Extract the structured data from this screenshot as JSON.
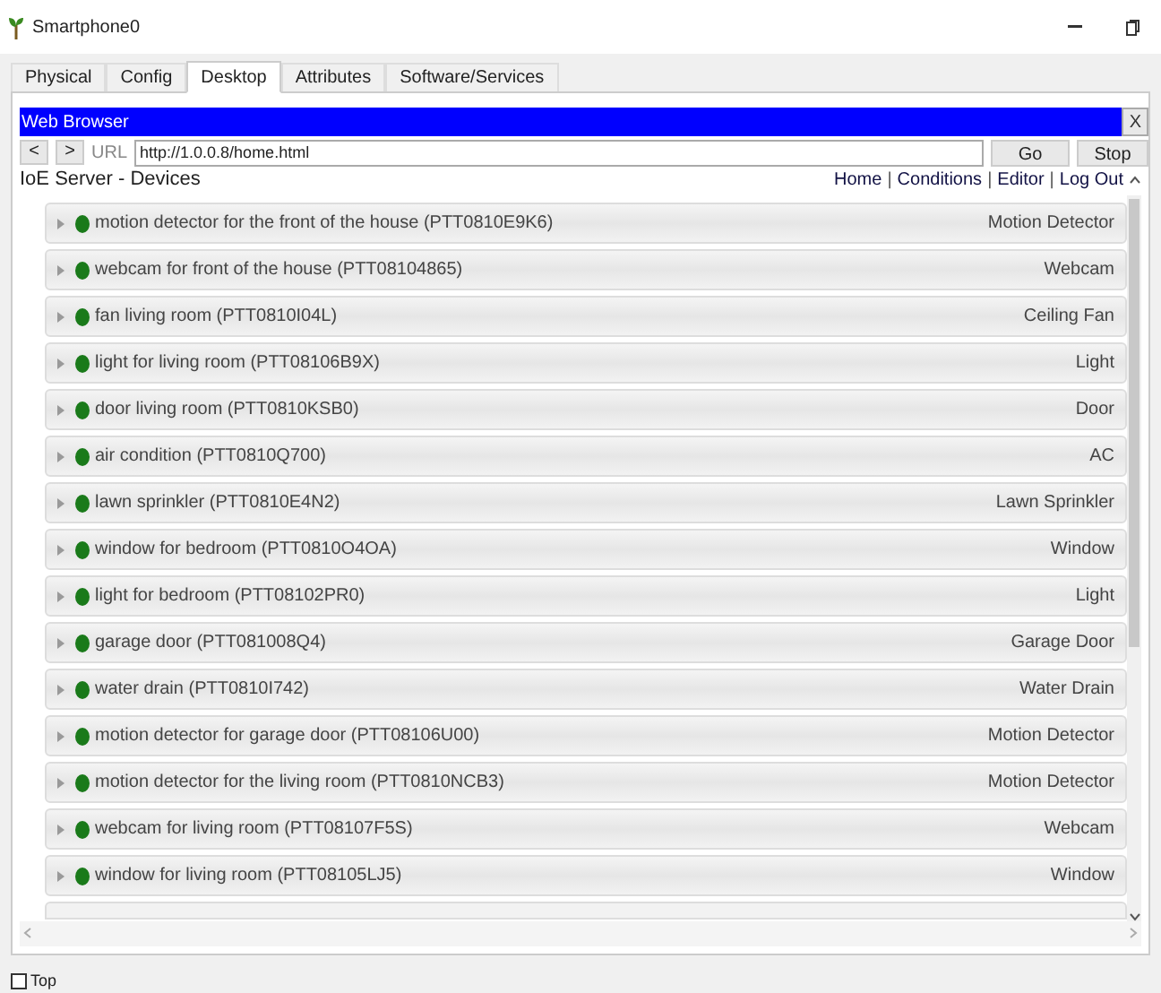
{
  "window": {
    "title": "Smartphone0"
  },
  "tabs": [
    {
      "label": "Physical",
      "selected": false
    },
    {
      "label": "Config",
      "selected": false
    },
    {
      "label": "Desktop",
      "selected": true
    },
    {
      "label": "Attributes",
      "selected": false
    },
    {
      "label": "Software/Services",
      "selected": false
    }
  ],
  "browser": {
    "title": "Web Browser",
    "close": "X",
    "back": "<",
    "forward": ">",
    "url_label": "URL",
    "url": "http://1.0.0.8/home.html",
    "go": "Go",
    "stop": "Stop"
  },
  "page": {
    "heading": "IoE Server - Devices",
    "nav": [
      {
        "kind": "link",
        "text": "Home"
      },
      {
        "kind": "separator",
        "text": "|"
      },
      {
        "kind": "link",
        "text": "Conditions"
      },
      {
        "kind": "separator",
        "text": "|"
      },
      {
        "kind": "link",
        "text": "Editor"
      },
      {
        "kind": "separator",
        "text": "|"
      },
      {
        "kind": "link",
        "text": "Log Out"
      }
    ],
    "devices": [
      {
        "name": "motion detector for the front of the house (PTT0810E9K6)",
        "type": "Motion Detector"
      },
      {
        "name": "webcam for front of the house (PTT08104865)",
        "type": "Webcam"
      },
      {
        "name": "fan living room (PTT0810I04L)",
        "type": "Ceiling Fan"
      },
      {
        "name": "light for living room (PTT08106B9X)",
        "type": "Light"
      },
      {
        "name": "door living room (PTT0810KSB0)",
        "type": "Door"
      },
      {
        "name": "air condition (PTT0810Q700)",
        "type": "AC"
      },
      {
        "name": "lawn sprinkler (PTT0810E4N2)",
        "type": "Lawn Sprinkler"
      },
      {
        "name": "window for bedroom (PTT0810O4OA)",
        "type": "Window"
      },
      {
        "name": "light for bedroom (PTT08102PR0)",
        "type": "Light"
      },
      {
        "name": "garage door (PTT081008Q4)",
        "type": "Garage Door"
      },
      {
        "name": "water drain (PTT0810I742)",
        "type": "Water Drain"
      },
      {
        "name": "motion detector for garage door (PTT08106U00)",
        "type": "Motion Detector"
      },
      {
        "name": "motion detector for the living room (PTT0810NCB3)",
        "type": "Motion Detector"
      },
      {
        "name": "webcam for living room (PTT08107F5S)",
        "type": "Webcam"
      },
      {
        "name": "window for living room (PTT08105LJ5)",
        "type": "Window"
      }
    ]
  },
  "footer": {
    "label": "Top",
    "checked": false
  }
}
